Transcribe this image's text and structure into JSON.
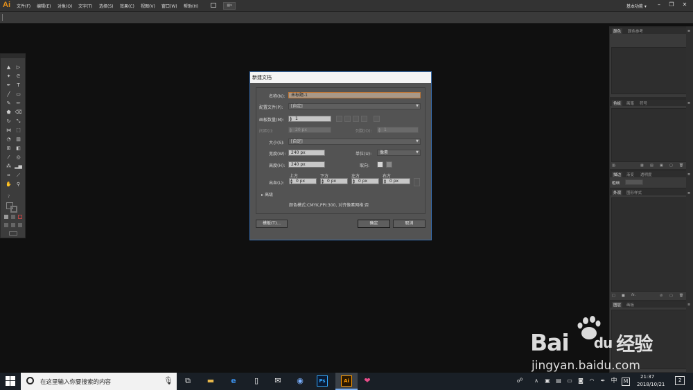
{
  "app": {
    "logo": "Ai"
  },
  "menu": [
    "文件(F)",
    "编辑(E)",
    "对象(O)",
    "文字(T)",
    "选择(S)",
    "效果(C)",
    "视图(V)",
    "窗口(W)",
    "帮助(H)"
  ],
  "workspace": "基本功能",
  "window_controls": {
    "minimize": "–",
    "restore": "❐",
    "close": "✕"
  },
  "right_panels": {
    "color_tabs": [
      "颜色",
      "颜色参考"
    ],
    "swatch_tabs": [
      "色板",
      "画笔",
      "符号"
    ],
    "stroke_tabs": [
      "描边",
      "渐变",
      "透明度"
    ],
    "stroke_label": "粗细",
    "appearance_tabs": [
      "外观",
      "图形样式"
    ],
    "layers_tabs": [
      "图层",
      "画板"
    ]
  },
  "dialog": {
    "title": "新建文档",
    "name_label": "名称(N):",
    "name_value": "未标题-1",
    "profile_label": "配置文件(P):",
    "profile_value": "[自定]",
    "artboards_label": "画板数量(M):",
    "artboards_value": "1",
    "spacing_label": "间距(I):",
    "spacing_value": "20 px",
    "columns_label": "列数(O):",
    "columns_value": "1",
    "size_label": "大小(S):",
    "size_value": "[自定]",
    "width_label": "宽度(W):",
    "width_value": "240 px",
    "units_label": "单位(U):",
    "units_value": "像素",
    "height_label": "高度(H):",
    "height_value": "240 px",
    "orientation_label": "取向:",
    "bleed_label": "出血(L):",
    "bleed_top_label": "上方",
    "bleed_bottom_label": "下方",
    "bleed_left_label": "左方",
    "bleed_right_label": "右方",
    "bleed_top": "0 px",
    "bleed_bottom": "0 px",
    "bleed_left": "0 px",
    "bleed_right": "0 px",
    "advanced_label": "高级",
    "info": "颜色模式:CMYK,PPI:300, 对齐像素网格:否",
    "templates_btn": "模板(T)...",
    "ok_btn": "确定",
    "cancel_btn": "取消"
  },
  "taskbar": {
    "search_placeholder": "在这里输入你要搜索的内容",
    "time": "21:37",
    "date": "2018/10/21",
    "ime": "中",
    "ime_mode": "M",
    "notification_count": "2"
  },
  "watermark": {
    "brand": "Bai",
    "brand2": "du",
    "cn": "经验",
    "url": "jingyan.baidu.com"
  }
}
